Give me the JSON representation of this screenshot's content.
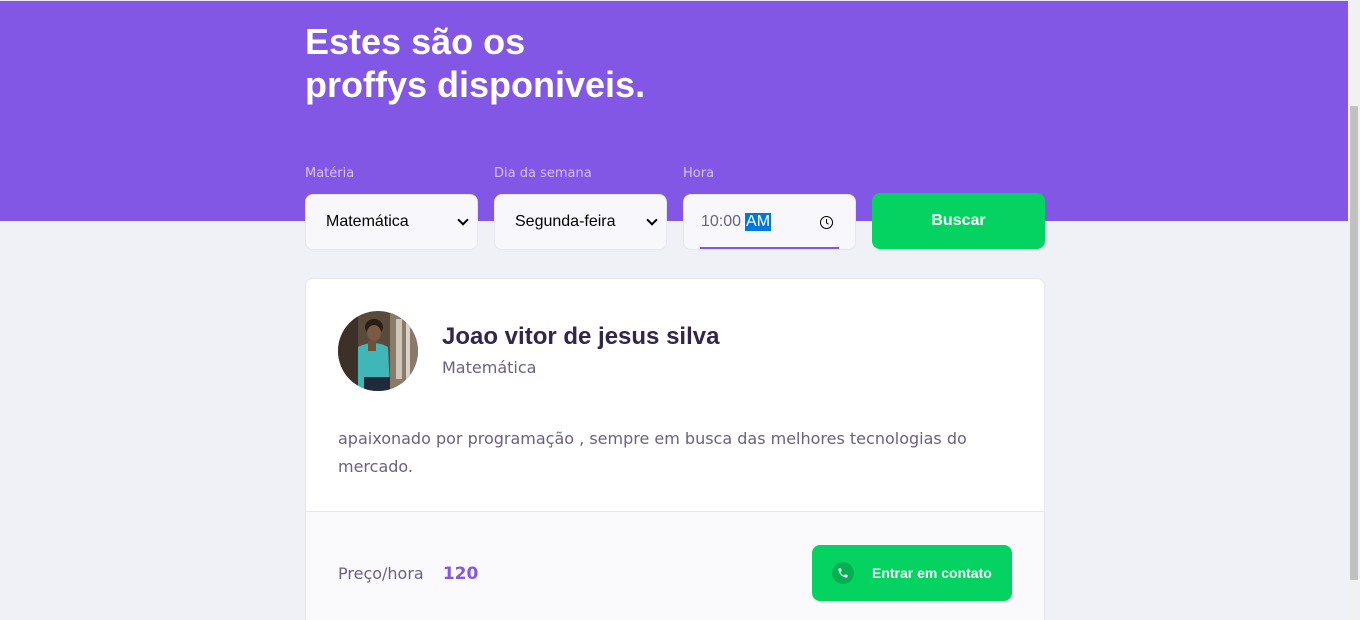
{
  "header": {
    "title_line1": "Estes são os",
    "title_line2": "proffys disponiveis."
  },
  "search": {
    "subject_label": "Matéria",
    "subject_value": "Matemática",
    "weekday_label": "Dia da semana",
    "weekday_value": "Segunda-feira",
    "time_label": "Hora",
    "time_value": "10:00",
    "time_ampm": "AM",
    "submit_label": "Buscar"
  },
  "teacher": {
    "name": "Joao vitor de jesus silva",
    "subject": "Matemática",
    "bio": "apaixonado por programação , sempre em busca das melhores tecnologias do mercado.",
    "price_label": "Preço/hora",
    "price_value": "120",
    "contact_label": "Entrar em contato",
    "contact_icon": "whatsapp-icon"
  },
  "colors": {
    "primary": "#8257E5",
    "secondary": "#04D361",
    "background": "#F0F0F7"
  }
}
